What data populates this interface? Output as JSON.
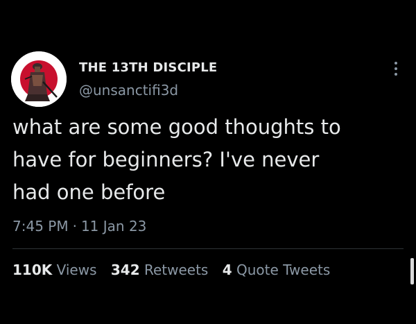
{
  "author": {
    "display_name": "THE 13TH DISCIPLE",
    "handle": "@unsanctifi3d",
    "avatar_icon": "samurai-figure-avatar"
  },
  "tweet": {
    "text_lines": [
      "what are some good thoughts to",
      "have for beginners? I've never",
      "had one before"
    ],
    "time": "7:45 PM",
    "separator": "·",
    "date": "11 Jan 23"
  },
  "stats": {
    "views": {
      "count": "110K",
      "label": "Views"
    },
    "retweets": {
      "count": "342",
      "label": "Retweets"
    },
    "quote_tweets": {
      "count": "4",
      "label": "Quote Tweets"
    }
  },
  "icons": {
    "more": "more-vertical-icon"
  },
  "colors": {
    "background": "#000000",
    "primary_text": "#e7e9ea",
    "secondary_text": "#8b98a5",
    "divider": "#2f3336",
    "avatar_accent": "#c8102e"
  }
}
